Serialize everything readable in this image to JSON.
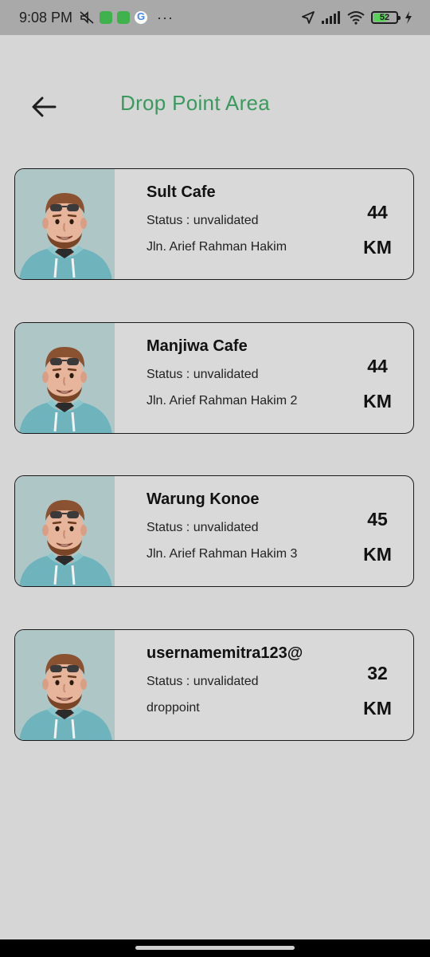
{
  "status_bar": {
    "time": "9:08 PM",
    "dots": "···",
    "battery": "52",
    "icons": [
      "mute-icon",
      "app-notification-icon",
      "app-notification-icon",
      "google-icon",
      "location-arrow-icon",
      "signal-icon",
      "wifi-icon",
      "battery-icon",
      "charging-icon"
    ]
  },
  "header": {
    "title": "Drop Point Area",
    "back_icon": "arrow-left-icon",
    "accent_color": "#3a9a5e"
  },
  "drop_points": [
    {
      "name": "Sult Cafe",
      "status": "Status : unvalidated",
      "address": "Jln. Arief Rahman Hakim",
      "distance": "44",
      "unit": "KM"
    },
    {
      "name": "Manjiwa Cafe",
      "status": "Status : unvalidated",
      "address": "Jln. Arief Rahman Hakim 2",
      "distance": "44",
      "unit": "KM"
    },
    {
      "name": "Warung Konoe",
      "status": "Status : unvalidated",
      "address": "Jln. Arief Rahman Hakim 3",
      "distance": "45",
      "unit": "KM"
    },
    {
      "name": "usernamemitra123@",
      "status": "Status : unvalidated",
      "address": "droppoint",
      "distance": "32",
      "unit": "KM"
    }
  ]
}
